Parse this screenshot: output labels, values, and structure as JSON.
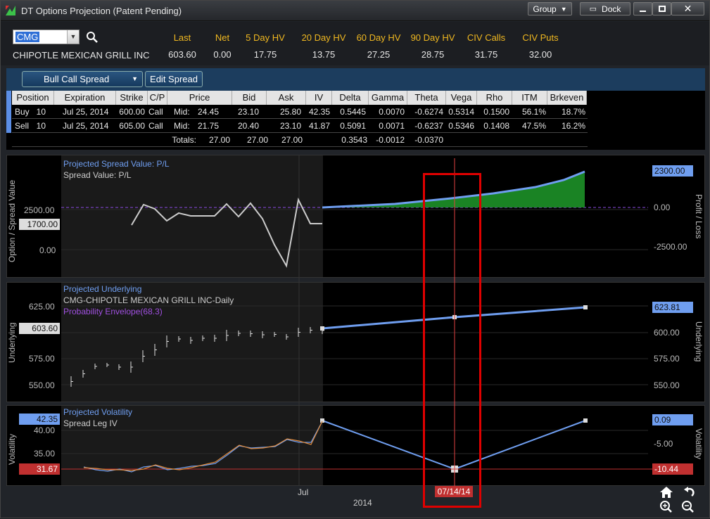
{
  "window": {
    "title": "DT Options Projection (Patent Pending)",
    "group_label": "Group",
    "dock_label": "Dock"
  },
  "quote": {
    "symbol": "CMG",
    "company": "CHIPOTLE MEXICAN GRILL INC",
    "headers": [
      "Last",
      "Net",
      "5 Day HV",
      "20 Day HV",
      "60 Day HV",
      "90 Day HV",
      "CIV Calls",
      "CIV Puts"
    ],
    "values": [
      "603.60",
      "0.00",
      "17.75",
      "13.75",
      "27.25",
      "28.75",
      "31.75",
      "32.00"
    ]
  },
  "spread": {
    "type": "Bull Call Spread",
    "edit_label": "Edit Spread"
  },
  "table": {
    "columns": [
      "Position",
      "Expiration",
      "Strike",
      "C/P",
      "Price",
      "Bid",
      "Ask",
      "IV",
      "Delta",
      "Gamma",
      "Theta",
      "Vega",
      "Rho",
      "ITM",
      "Brkeven"
    ],
    "rows": [
      [
        "Buy",
        "10",
        "Jul 25, 2014",
        "600.00",
        "Call",
        "Mid:",
        "24.45",
        "23.10",
        "25.80",
        "42.35",
        "0.5445",
        "0.0070",
        "-0.6274",
        "0.5314",
        "0.1500",
        "56.1%",
        "18.7%"
      ],
      [
        "Sell",
        "10",
        "Jul 25, 2014",
        "605.00",
        "Call",
        "Mid:",
        "21.75",
        "20.40",
        "23.10",
        "41.87",
        "0.5091",
        "0.0071",
        "-0.6237",
        "0.5346",
        "0.1408",
        "47.5%",
        "16.2%"
      ]
    ],
    "totals": {
      "label": "Totals:",
      "price": "27.00",
      "bid": "27.00",
      "ask": "27.00",
      "delta": "0.3543",
      "gamma": "-0.0012",
      "theta": "-0.0370"
    }
  },
  "pl_panel": {
    "title": "Projected Spread Value: P/L",
    "subtitle": "Spread Value: P/L",
    "left_axis_label": "Option / Spread Value",
    "right_axis_label": "Profit / Loss",
    "left_ticks": [
      "2500.00",
      "0.00"
    ],
    "left_tag": "1700.00",
    "right_ticks": [
      "0.00",
      "-2500.00"
    ],
    "right_tag": "2300.00"
  },
  "und_panel": {
    "title": "Projected Underlying",
    "subtitle": "CMG-CHIPOTLE MEXICAN GRILL INC-Daily",
    "envelope": "Probability Envelope(68.3)",
    "axis_label": "Underlying",
    "left_ticks": [
      "625.00",
      "575.00",
      "550.00"
    ],
    "left_tag": "603.60",
    "right_ticks": [
      "600.00",
      "575.00",
      "550.00"
    ],
    "right_tag": "623.81"
  },
  "vol_panel": {
    "title": "Projected Volatility",
    "subtitle": "Spread Leg IV",
    "axis_label": "Volatility",
    "left_ticks": [
      "40.00",
      "35.00"
    ],
    "left_tag_top": "42.35",
    "left_tag_bottom": "31.67",
    "right_ticks": [
      "-5.00"
    ],
    "right_tag_top": "0.09",
    "right_tag_bottom": "-10.44"
  },
  "x_axis": {
    "month_label": "Jul",
    "year_label": "2014",
    "cursor_date": "07/14/14"
  },
  "colors": {
    "accent_blue": "#6f9ef0",
    "positive_green": "#1e9a2a",
    "negative_red": "#c03030",
    "header_gold": "#f0b820",
    "highlight_box": "#e00000"
  }
}
